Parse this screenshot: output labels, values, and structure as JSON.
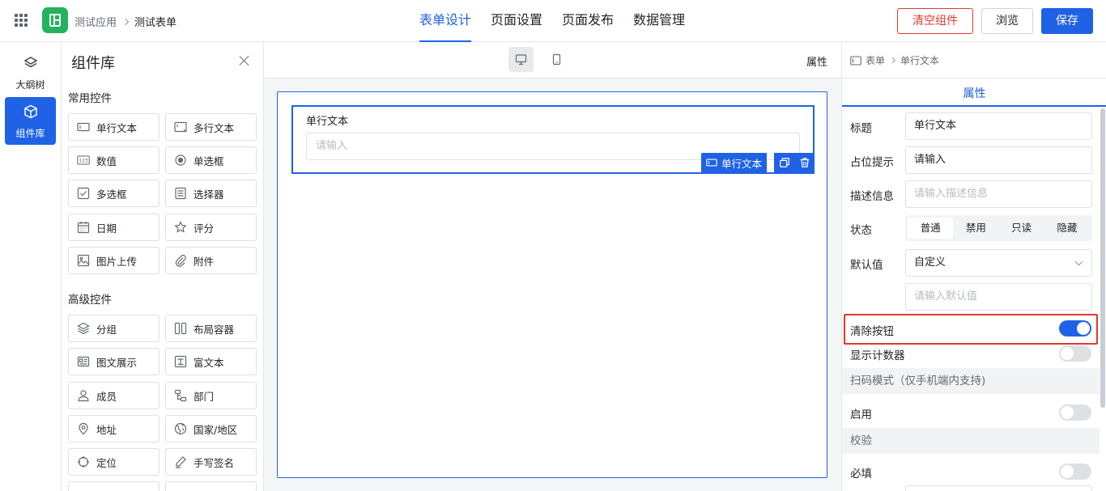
{
  "header": {
    "breadcrumb": [
      "测试应用",
      "测试表单"
    ],
    "tabs": [
      {
        "label": "表单设计",
        "active": true
      },
      {
        "label": "页面设置",
        "active": false
      },
      {
        "label": "页面发布",
        "active": false
      },
      {
        "label": "数据管理",
        "active": false
      }
    ],
    "clear_label": "清空组件",
    "preview_label": "浏览",
    "save_label": "保存"
  },
  "rail": {
    "outline_label": "大纲树",
    "library_label": "组件库"
  },
  "library": {
    "title": "组件库",
    "common_title": "常用控件",
    "advanced_title": "高级控件",
    "common": [
      {
        "label": "单行文本",
        "icon": "single-line-icon"
      },
      {
        "label": "多行文本",
        "icon": "multi-line-icon"
      },
      {
        "label": "数值",
        "icon": "number-icon"
      },
      {
        "label": "单选框",
        "icon": "radio-icon"
      },
      {
        "label": "多选框",
        "icon": "checkbox-icon"
      },
      {
        "label": "选择器",
        "icon": "selector-icon"
      },
      {
        "label": "日期",
        "icon": "calendar-icon"
      },
      {
        "label": "评分",
        "icon": "star-icon"
      },
      {
        "label": "图片上传",
        "icon": "image-icon"
      },
      {
        "label": "附件",
        "icon": "paperclip-icon"
      }
    ],
    "advanced": [
      {
        "label": "分组",
        "icon": "layers-icon"
      },
      {
        "label": "布局容器",
        "icon": "columns-icon"
      },
      {
        "label": "图文展示",
        "icon": "card-icon"
      },
      {
        "label": "富文本",
        "icon": "rich-text-icon"
      },
      {
        "label": "成员",
        "icon": "user-icon"
      },
      {
        "label": "部门",
        "icon": "org-icon"
      },
      {
        "label": "地址",
        "icon": "map-pin-icon"
      },
      {
        "label": "国家/地区",
        "icon": "globe-icon"
      },
      {
        "label": "定位",
        "icon": "locate-icon"
      },
      {
        "label": "手写签名",
        "icon": "pen-icon"
      }
    ]
  },
  "canvas": {
    "header_label": "属性",
    "field_label": "单行文本",
    "field_placeholder": "请输入",
    "field_tag": "单行文本"
  },
  "props": {
    "breadcrumb": [
      "表单",
      "单行文本"
    ],
    "tab_label": "属性",
    "title_label": "标题",
    "title_value": "单行文本",
    "placeholder_label": "占位提示",
    "placeholder_value": "请输入",
    "desc_label": "描述信息",
    "desc_placeholder": "请输入描述信息",
    "state_label": "状态",
    "state_options": [
      "普通",
      "禁用",
      "只读",
      "隐藏"
    ],
    "state_selected": "普通",
    "default_label": "默认值",
    "default_mode": "自定义",
    "default_placeholder": "请输入默认值",
    "clear_btn_label": "清除按钮",
    "clear_btn_on": true,
    "counter_label": "显示计数器",
    "counter_on": false,
    "scan_section": "扫码模式（仅手机端内支持)",
    "enable_label": "启用",
    "enable_on": false,
    "validate_section": "校验",
    "required_label": "必填",
    "required_on": false
  },
  "colors": {
    "primary": "#1f62e5",
    "danger": "#e0392f",
    "logo": "#22b35e"
  }
}
